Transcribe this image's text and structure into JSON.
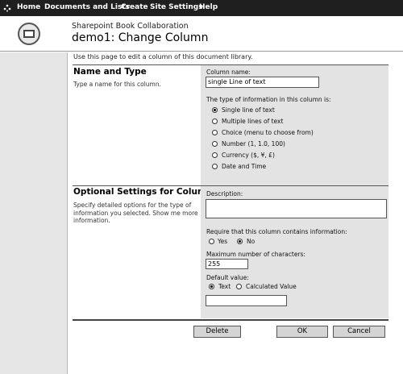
{
  "topnav": {
    "items": [
      "Home",
      "Documents and Lists",
      "Create",
      "Site Settings",
      "Help"
    ]
  },
  "header": {
    "site_name": "Sharepoint Book Collaboration",
    "page_title": "demo1: Change Column"
  },
  "intro_text": "Use this page to edit a column of this document library.",
  "name_section": {
    "title": "Name and Type",
    "description": "Type a name for this column.",
    "column_name_label": "Column name:",
    "column_name_value": "single Line of text",
    "type_label": "The type of information in this column is:",
    "type_options": [
      {
        "label": "Single line of text",
        "selected": true
      },
      {
        "label": "Multiple lines of text",
        "selected": false
      },
      {
        "label": "Choice (menu to choose from)",
        "selected": false
      },
      {
        "label": "Number (1, 1.0, 100)",
        "selected": false
      },
      {
        "label": "Currency ($, ¥, £)",
        "selected": false
      },
      {
        "label": "Date and Time",
        "selected": false
      }
    ]
  },
  "optional_section": {
    "title": "Optional Settings for Column",
    "description": "Specify detailed options for the type of information you selected. Show me more information.",
    "description_label": "Description:",
    "description_value": "",
    "require_label": "Require that this column contains information:",
    "require_yes": "Yes",
    "require_no": "No",
    "require_selected": "No",
    "max_chars_label": "Maximum number of characters:",
    "max_chars_value": "255",
    "default_label": "Default value:",
    "default_text_option": "Text",
    "default_calc_option": "Calculated Value",
    "default_selected": "Text",
    "default_value": ""
  },
  "buttons": {
    "delete": "Delete",
    "ok": "OK",
    "cancel": "Cancel"
  },
  "scroll_glyphs": {
    "up": "▲",
    "down": "▼"
  }
}
